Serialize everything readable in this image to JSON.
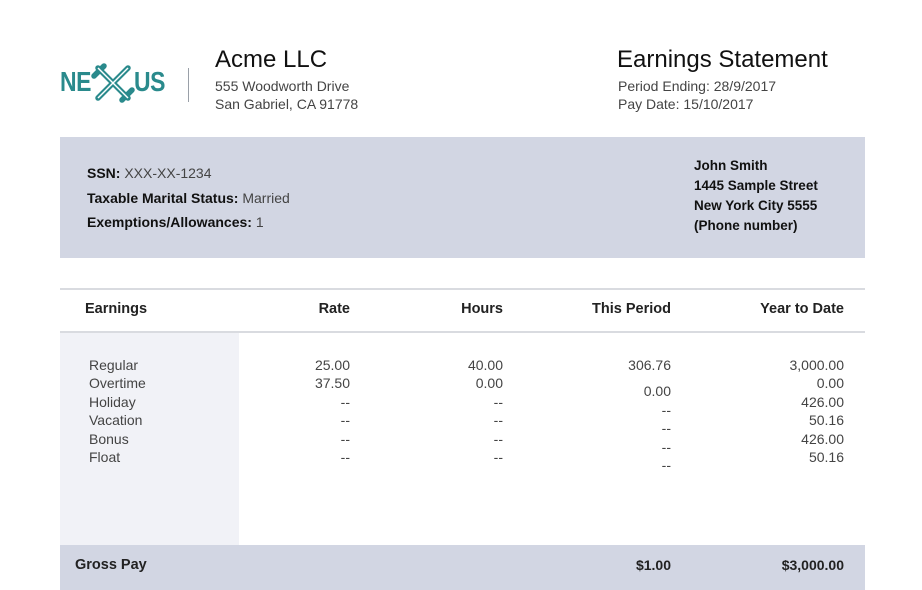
{
  "brand": {
    "logo_left": "NE",
    "logo_right": "US",
    "logo_color": "#2a8a8c"
  },
  "company": {
    "name": "Acme LLC",
    "address_line1": "555 Woodworth Drive",
    "address_line2": "San Gabriel, CA  91778"
  },
  "statement": {
    "title": "Earnings Statement",
    "period_ending": "Period Ending: 28/9/2017",
    "pay_date": "Pay Date: 15/10/2017"
  },
  "employee_info": {
    "ssn_label": "SSN:",
    "ssn_value": "XXX-XX-1234",
    "marital_label": "Taxable Marital Status:",
    "marital_value": "Married",
    "exemptions_label": "Exemptions/Allowances:",
    "exemptions_value": "1"
  },
  "employee": {
    "name": "John Smith",
    "street": "1445 Sample Street",
    "city": "New York City 5555",
    "phone": "(Phone number)"
  },
  "table": {
    "headers": {
      "earnings": "Earnings",
      "rate": "Rate",
      "hours": "Hours",
      "this_period": "This Period",
      "ytd": "Year to Date"
    },
    "labels": [
      "Regular",
      "Overtime",
      "Holiday",
      "Vacation",
      "Bonus",
      "Float"
    ],
    "rate": [
      "25.00",
      "37.50",
      "--",
      "--",
      "--",
      "--"
    ],
    "hours": [
      "40.00",
      "0.00",
      "--",
      "--",
      "--",
      "--"
    ],
    "this_period": [
      "306.76",
      "0.00",
      "--",
      "--",
      "--",
      "--"
    ],
    "ytd": [
      "3,000.00",
      "0.00",
      "426.00",
      "50.16",
      "426.00",
      "50.16"
    ]
  },
  "gross": {
    "label": "Gross Pay",
    "this_period": "$1.00",
    "ytd": "$3,000.00"
  },
  "colors": {
    "panel": "#d2d6e3",
    "label_column": "#f1f2f7"
  }
}
